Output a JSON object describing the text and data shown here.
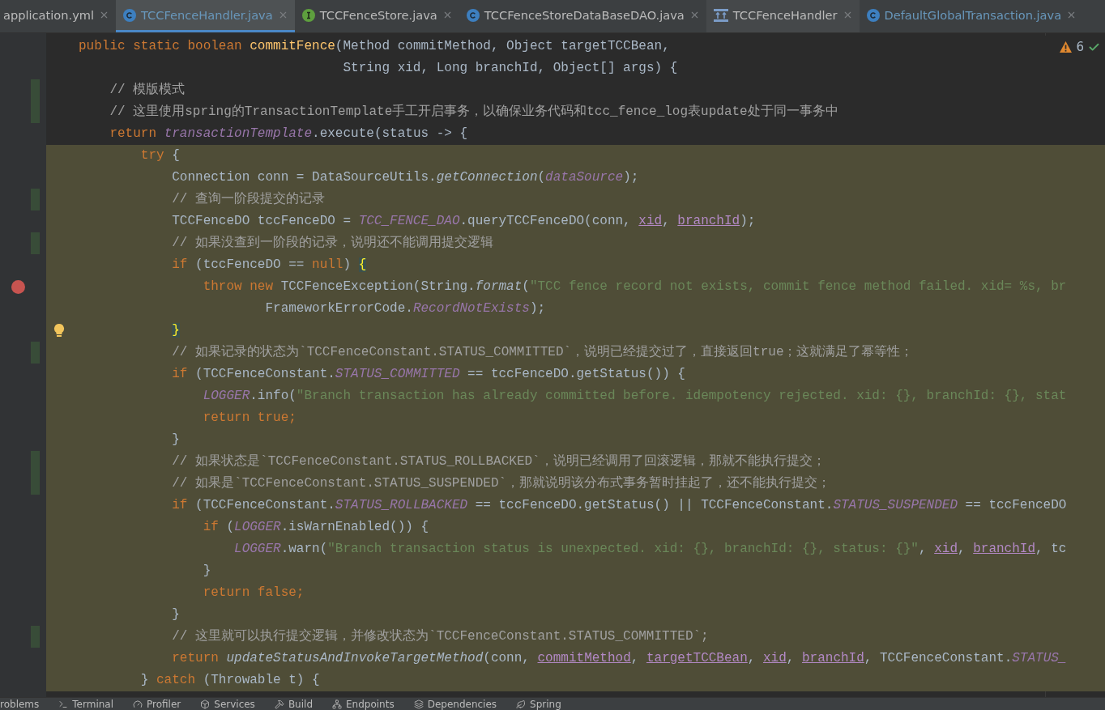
{
  "tabs": [
    {
      "label": "application.yml",
      "kind": "plain",
      "selected": false,
      "modified": false
    },
    {
      "label": "TCCFenceHandler.java",
      "kind": "class",
      "selected": true,
      "modified": true
    },
    {
      "label": "TCCFenceStore.java",
      "kind": "interface",
      "selected": false,
      "modified": false
    },
    {
      "label": "TCCFenceStoreDataBaseDAO.java",
      "kind": "class",
      "selected": false,
      "modified": false
    },
    {
      "label": "TCCFenceHandler",
      "kind": "diagram",
      "selected": false,
      "modified": false
    },
    {
      "label": "DefaultGlobalTransaction.java",
      "kind": "class",
      "selected": false,
      "modified": true
    }
  ],
  "inspections": {
    "warnings": "6"
  },
  "lines": [
    {
      "highlighted": false,
      "changed": false,
      "tokens": [
        {
          "kind": "kw",
          "text": "public static boolean "
        },
        {
          "kind": "method",
          "text": "commitFence"
        },
        {
          "kind": "plain",
          "text": "(Method commitMethod, Object targetTCCBean,"
        }
      ]
    },
    {
      "highlighted": false,
      "changed": false,
      "tokens": [
        {
          "kind": "plain",
          "text": "                                  String xid, Long branchId, Object[] args) {"
        }
      ]
    },
    {
      "highlighted": false,
      "changed": true,
      "tokens": [
        {
          "kind": "comment",
          "text": "    // 模版模式"
        }
      ]
    },
    {
      "highlighted": false,
      "changed": true,
      "tokens": [
        {
          "kind": "comment",
          "text": "    // 这里使用spring的TransactionTemplate手工开启事务，以确保业务代码和tcc_fence_log表update处于同一事务中"
        }
      ]
    },
    {
      "highlighted": false,
      "changed": false,
      "tokens": [
        {
          "kind": "kw",
          "text": "    return "
        },
        {
          "kind": "field",
          "text": "transactionTemplate"
        },
        {
          "kind": "plain",
          "text": ".execute(status -> {"
        }
      ]
    },
    {
      "highlighted": true,
      "changed": false,
      "tokens": [
        {
          "kind": "kw",
          "text": "        try"
        },
        {
          "kind": "plain",
          "text": " {"
        }
      ]
    },
    {
      "highlighted": true,
      "changed": false,
      "tokens": [
        {
          "kind": "plain",
          "text": "            Connection conn = DataSourceUtils."
        },
        {
          "kind": "static",
          "text": "getConnection"
        },
        {
          "kind": "plain",
          "text": "("
        },
        {
          "kind": "field",
          "text": "dataSource"
        },
        {
          "kind": "plain",
          "text": ");"
        }
      ]
    },
    {
      "highlighted": true,
      "changed": true,
      "tokens": [
        {
          "kind": "comment",
          "text": "            // 查询一阶段提交的记录"
        }
      ]
    },
    {
      "highlighted": true,
      "changed": false,
      "tokens": [
        {
          "kind": "plain",
          "text": "            TCCFenceDO tccFenceDO = "
        },
        {
          "kind": "field",
          "text": "TCC_FENCE_DAO"
        },
        {
          "kind": "plain",
          "text": ".queryTCCFenceDO(conn, "
        },
        {
          "kind": "param",
          "text": "xid"
        },
        {
          "kind": "plain",
          "text": ", "
        },
        {
          "kind": "param",
          "text": "branchId"
        },
        {
          "kind": "plain",
          "text": ");"
        }
      ]
    },
    {
      "highlighted": true,
      "changed": true,
      "tokens": [
        {
          "kind": "comment",
          "text": "            // 如果没查到一阶段的记录，说明还不能调用提交逻辑"
        }
      ]
    },
    {
      "highlighted": true,
      "changed": false,
      "tokens": [
        {
          "kind": "kw",
          "text": "            if"
        },
        {
          "kind": "plain",
          "text": " (tccFenceDO == "
        },
        {
          "kind": "kw",
          "text": "null"
        },
        {
          "kind": "plain",
          "text": ") "
        },
        {
          "kind": "brace",
          "text": "{"
        }
      ]
    },
    {
      "highlighted": true,
      "changed": false,
      "kind": "breakpoint",
      "tokens": [
        {
          "kind": "kw",
          "text": "                throw new "
        },
        {
          "kind": "plain",
          "text": "TCCFenceException(String."
        },
        {
          "kind": "static",
          "text": "format"
        },
        {
          "kind": "plain",
          "text": "("
        },
        {
          "kind": "string",
          "text": "\"TCC fence record not exists, commit fence method failed. xid= %s, br"
        }
      ]
    },
    {
      "highlighted": true,
      "changed": false,
      "tokens": [
        {
          "kind": "plain",
          "text": "                        FrameworkErrorCode."
        },
        {
          "kind": "field",
          "text": "RecordNotExists"
        },
        {
          "kind": "plain",
          "text": ");"
        }
      ]
    },
    {
      "highlighted": true,
      "changed": false,
      "kind": "intention",
      "tokens": [
        {
          "kind": "brace",
          "text": "            }"
        }
      ]
    },
    {
      "highlighted": true,
      "changed": true,
      "tokens": [
        {
          "kind": "comment",
          "text": "            // 如果记录的状态为`TCCFenceConstant.STATUS_COMMITTED`，说明已经提交过了，直接返回true；这就满足了幂等性；"
        }
      ]
    },
    {
      "highlighted": true,
      "changed": false,
      "tokens": [
        {
          "kind": "kw",
          "text": "            if"
        },
        {
          "kind": "plain",
          "text": " (TCCFenceConstant."
        },
        {
          "kind": "field",
          "text": "STATUS_COMMITTED"
        },
        {
          "kind": "plain",
          "text": " == tccFenceDO.getStatus()) {"
        }
      ]
    },
    {
      "highlighted": true,
      "changed": false,
      "tokens": [
        {
          "kind": "field",
          "text": "                LOGGER"
        },
        {
          "kind": "plain",
          "text": ".info("
        },
        {
          "kind": "string",
          "text": "\"Branch transaction has already committed before. idempotency rejected. xid: {}, branchId: {}, stat"
        }
      ]
    },
    {
      "highlighted": true,
      "changed": false,
      "tokens": [
        {
          "kind": "kw",
          "text": "                return true;"
        }
      ]
    },
    {
      "highlighted": true,
      "changed": false,
      "tokens": [
        {
          "kind": "plain",
          "text": "            }"
        }
      ]
    },
    {
      "highlighted": true,
      "changed": true,
      "tokens": [
        {
          "kind": "comment",
          "text": "            // 如果状态是`TCCFenceConstant.STATUS_ROLLBACKED`，说明已经调用了回滚逻辑，那就不能执行提交；"
        }
      ]
    },
    {
      "highlighted": true,
      "changed": true,
      "tokens": [
        {
          "kind": "comment",
          "text": "            // 如果是`TCCFenceConstant.STATUS_SUSPENDED`，那就说明该分布式事务暂时挂起了，还不能执行提交；"
        }
      ]
    },
    {
      "highlighted": true,
      "changed": false,
      "tokens": [
        {
          "kind": "kw",
          "text": "            if"
        },
        {
          "kind": "plain",
          "text": " (TCCFenceConstant."
        },
        {
          "kind": "field",
          "text": "STATUS_ROLLBACKED"
        },
        {
          "kind": "plain",
          "text": " == tccFenceDO.getStatus() || TCCFenceConstant."
        },
        {
          "kind": "field",
          "text": "STATUS_SUSPENDED"
        },
        {
          "kind": "plain",
          "text": " == tccFenceDO"
        }
      ]
    },
    {
      "highlighted": true,
      "changed": false,
      "tokens": [
        {
          "kind": "kw",
          "text": "                if"
        },
        {
          "kind": "plain",
          "text": " ("
        },
        {
          "kind": "field",
          "text": "LOGGER"
        },
        {
          "kind": "plain",
          "text": ".isWarnEnabled()) {"
        }
      ]
    },
    {
      "highlighted": true,
      "changed": false,
      "tokens": [
        {
          "kind": "field",
          "text": "                    LOGGER"
        },
        {
          "kind": "plain",
          "text": ".warn("
        },
        {
          "kind": "string",
          "text": "\"Branch transaction status is unexpected. xid: {}, branchId: {}, status: {}\""
        },
        {
          "kind": "plain",
          "text": ", "
        },
        {
          "kind": "param",
          "text": "xid"
        },
        {
          "kind": "plain",
          "text": ", "
        },
        {
          "kind": "param",
          "text": "branchId"
        },
        {
          "kind": "plain",
          "text": ", tc"
        }
      ]
    },
    {
      "highlighted": true,
      "changed": false,
      "tokens": [
        {
          "kind": "plain",
          "text": "                }"
        }
      ]
    },
    {
      "highlighted": true,
      "changed": false,
      "tokens": [
        {
          "kind": "kw",
          "text": "                return false;"
        }
      ]
    },
    {
      "highlighted": true,
      "changed": false,
      "tokens": [
        {
          "kind": "plain",
          "text": "            }"
        }
      ]
    },
    {
      "highlighted": true,
      "changed": true,
      "tokens": [
        {
          "kind": "comment",
          "text": "            // 这里就可以执行提交逻辑，并修改状态为`TCCFenceConstant.STATUS_COMMITTED`;"
        }
      ]
    },
    {
      "highlighted": true,
      "changed": false,
      "tokens": [
        {
          "kind": "kw",
          "text": "            return "
        },
        {
          "kind": "static",
          "text": "updateStatusAndInvokeTargetMethod"
        },
        {
          "kind": "plain",
          "text": "(conn, "
        },
        {
          "kind": "param",
          "text": "commitMethod"
        },
        {
          "kind": "plain",
          "text": ", "
        },
        {
          "kind": "param",
          "text": "targetTCCBean"
        },
        {
          "kind": "plain",
          "text": ", "
        },
        {
          "kind": "param",
          "text": "xid"
        },
        {
          "kind": "plain",
          "text": ", "
        },
        {
          "kind": "param",
          "text": "branchId"
        },
        {
          "kind": "plain",
          "text": ", TCCFenceConstant."
        },
        {
          "kind": "field",
          "text": "STATUS_"
        }
      ]
    },
    {
      "highlighted": true,
      "changed": false,
      "tokens": [
        {
          "kind": "plain",
          "text": "        } "
        },
        {
          "kind": "kw",
          "text": "catch"
        },
        {
          "kind": "plain",
          "text": " (Throwable t) {"
        }
      ]
    }
  ],
  "tool_windows": [
    {
      "label": "roblems",
      "kind": "plain"
    },
    {
      "label": "Terminal",
      "kind": "terminal"
    },
    {
      "label": "Profiler",
      "kind": "profiler"
    },
    {
      "label": "Services",
      "kind": "services"
    },
    {
      "label": "Build",
      "kind": "build"
    },
    {
      "label": "Endpoints",
      "kind": "endpoints"
    },
    {
      "label": "Dependencies",
      "kind": "dependencies"
    },
    {
      "label": "Spring",
      "kind": "spring"
    }
  ]
}
